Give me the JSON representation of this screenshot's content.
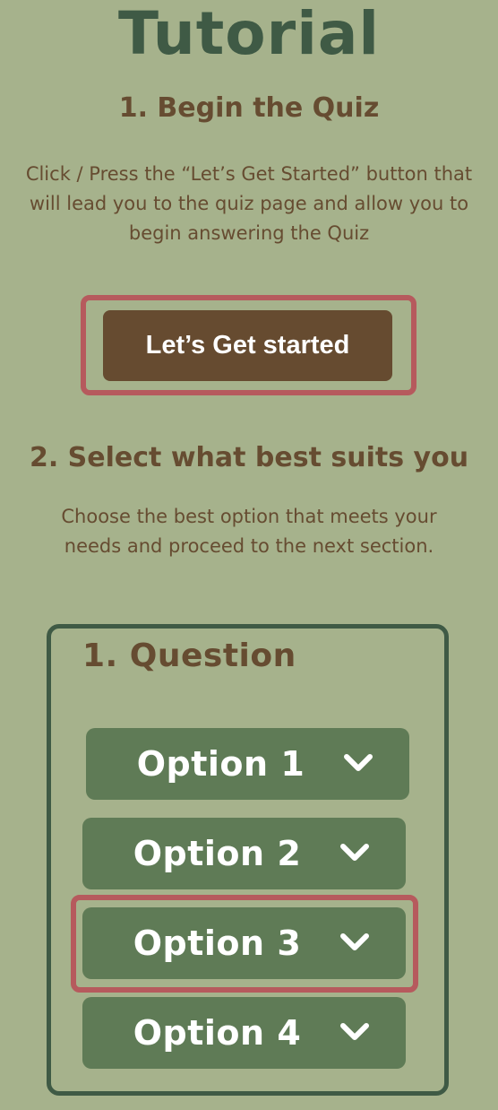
{
  "page": {
    "title": "Tutorial"
  },
  "step1": {
    "heading": "1. Begin the Quiz",
    "description": "Click / Press the “Let’s Get Started” button that will lead you to the quiz page and allow you to begin answering the Quiz",
    "button_label": "Let’s Get started"
  },
  "step2": {
    "heading": "2. Select what best suits you",
    "description": "Choose the best option that meets your needs and proceed to the next section."
  },
  "question": {
    "title": "1. Question",
    "options": [
      {
        "label": "Option 1",
        "icon": "chevron-down-icon"
      },
      {
        "label": "Option 2",
        "icon": "chevron-down-icon"
      },
      {
        "label": "Option 3",
        "icon": "chevron-down-icon",
        "highlighted": true
      },
      {
        "label": "Option 4",
        "icon": "chevron-down-icon"
      }
    ]
  },
  "colors": {
    "background": "#a6b28c",
    "title": "#3f5a45",
    "text_brown": "#664c31",
    "button_brown": "#664b30",
    "option_green": "#5f7b56",
    "highlight_red": "#b65a5d"
  }
}
